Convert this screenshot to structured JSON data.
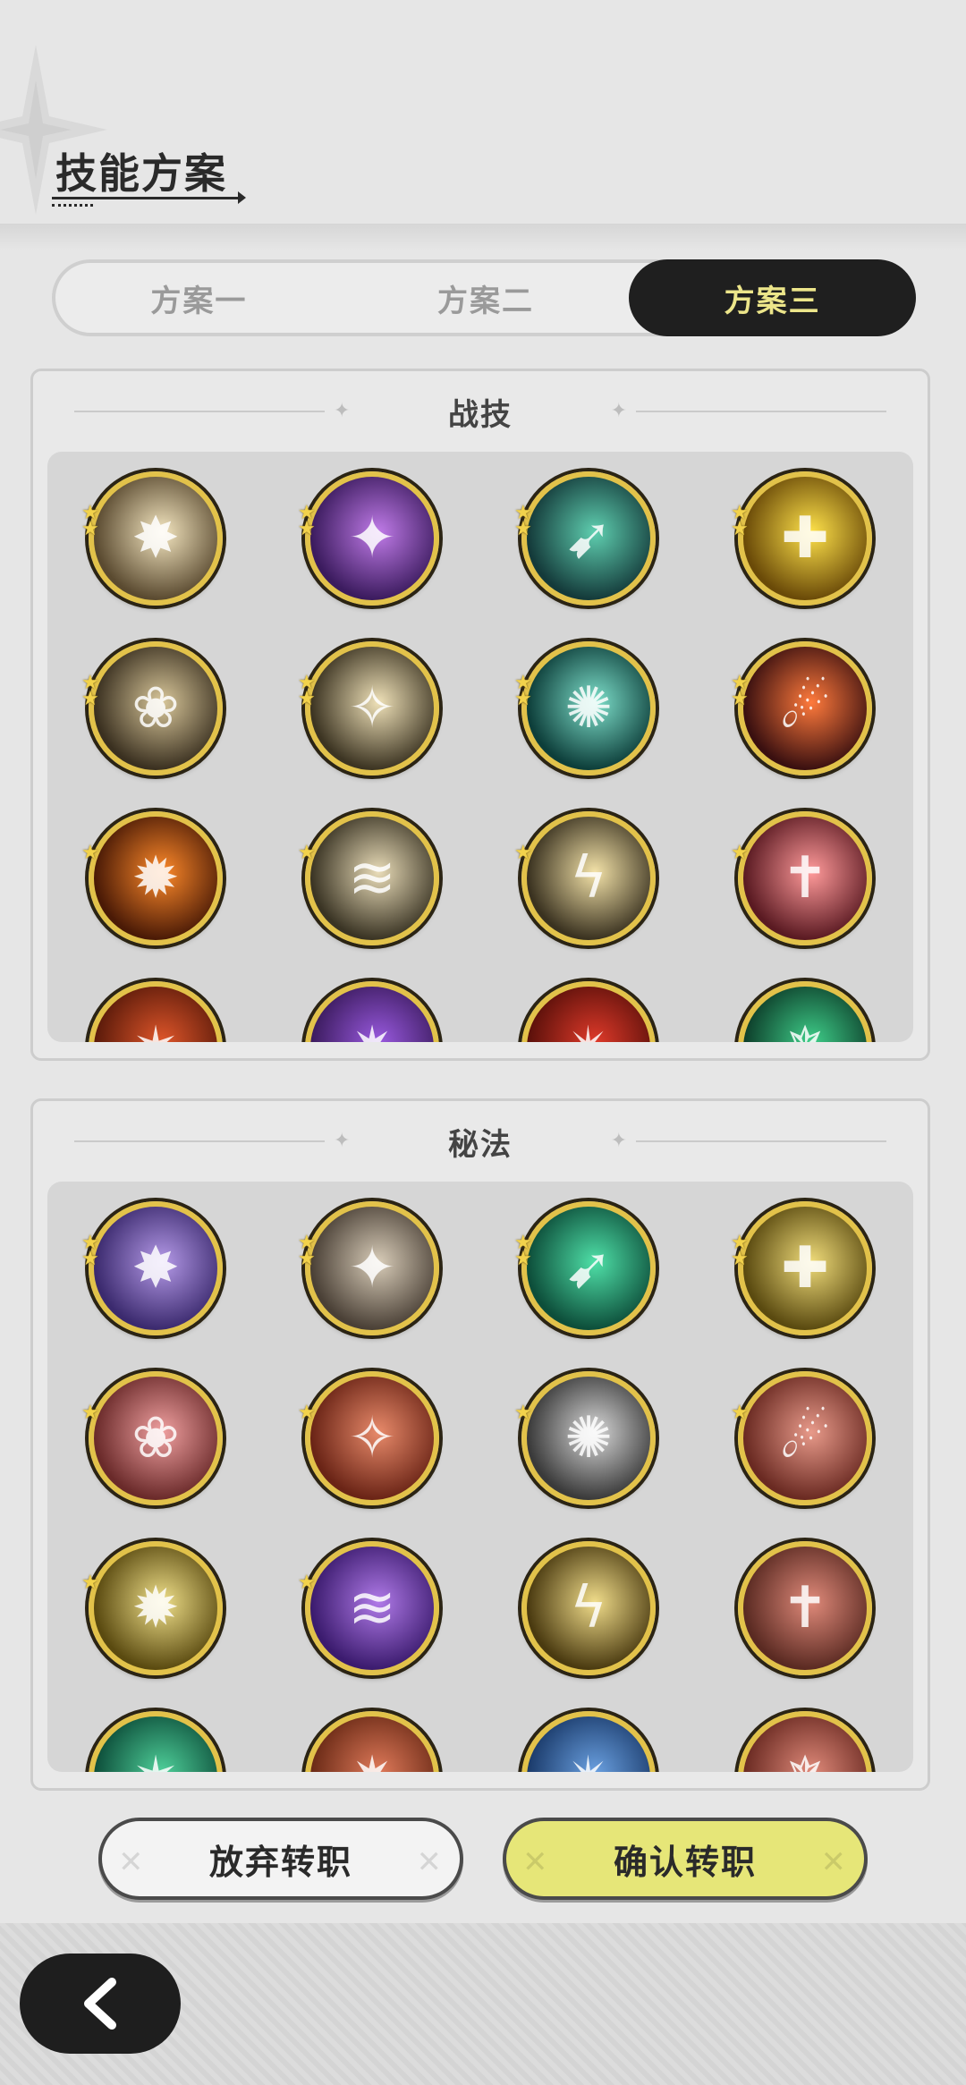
{
  "header": {
    "title": "技能方案"
  },
  "tabs": [
    {
      "label": "方案一",
      "active": false
    },
    {
      "label": "方案二",
      "active": false
    },
    {
      "label": "方案三",
      "active": true
    }
  ],
  "sections": {
    "combat": {
      "title": "战技",
      "skills": [
        {
          "icon": "burst-icon",
          "stars": 2,
          "colors": [
            "#5a4a30",
            "#f4e6c0"
          ]
        },
        {
          "icon": "purple-orb-icon",
          "stars": 2,
          "colors": [
            "#3b1b5e",
            "#c07be8"
          ]
        },
        {
          "icon": "green-slash-icon",
          "stars": 2,
          "colors": [
            "#143a3a",
            "#5fcfb0"
          ]
        },
        {
          "icon": "golden-shield-icon",
          "stars": 2,
          "colors": [
            "#6a4a08",
            "#ffe24a"
          ]
        },
        {
          "icon": "tail-sweep-icon",
          "stars": 2,
          "colors": [
            "#3a3020",
            "#d9c79a"
          ]
        },
        {
          "icon": "figure-leap-icon",
          "stars": 2,
          "colors": [
            "#3c3422",
            "#efe1b8"
          ]
        },
        {
          "icon": "web-icon",
          "stars": 2,
          "colors": [
            "#0d3e3a",
            "#7fe1cc"
          ]
        },
        {
          "icon": "fire-slash-icon",
          "stars": 2,
          "colors": [
            "#3a1010",
            "#ff7a3c"
          ]
        },
        {
          "icon": "flame-icon",
          "stars": 1,
          "colors": [
            "#4a1a06",
            "#ff8a2a"
          ]
        },
        {
          "icon": "wind-slash-icon",
          "stars": 1,
          "colors": [
            "#3a3424",
            "#e9dcb8"
          ]
        },
        {
          "icon": "lightning-slash-icon",
          "stars": 1,
          "colors": [
            "#3a3220",
            "#f3e2a8"
          ]
        },
        {
          "icon": "sword-raise-icon",
          "stars": 1,
          "colors": [
            "#5a1a22",
            "#ff9a9a"
          ]
        },
        {
          "icon": "red-skill-icon",
          "stars": 0,
          "colors": [
            "#5a1a0a",
            "#e0562a"
          ]
        },
        {
          "icon": "purple-skill-icon",
          "stars": 0,
          "colors": [
            "#3b1b5e",
            "#9a5ae0"
          ]
        },
        {
          "icon": "crimson-skill-icon",
          "stars": 0,
          "colors": [
            "#5a100a",
            "#e03a2a"
          ]
        },
        {
          "icon": "teal-skill-icon",
          "stars": 0,
          "colors": [
            "#0d3e2a",
            "#3fcf8a"
          ]
        }
      ]
    },
    "arcane": {
      "title": "秘法",
      "skills": [
        {
          "icon": "raven-icon",
          "stars": 2,
          "colors": [
            "#3b2a6e",
            "#b59ae8"
          ]
        },
        {
          "icon": "sword-up-icon",
          "stars": 2,
          "colors": [
            "#4a4036",
            "#d8ccb8"
          ]
        },
        {
          "icon": "emerald-sword-icon",
          "stars": 2,
          "colors": [
            "#0d4e3a",
            "#4fe0a8"
          ]
        },
        {
          "icon": "heal-guard-icon",
          "stars": 2,
          "colors": [
            "#5a4a10",
            "#f0dc7a"
          ]
        },
        {
          "icon": "red-sword-heal-icon",
          "stars": 1,
          "colors": [
            "#6a2a2a",
            "#f0a0a0"
          ]
        },
        {
          "icon": "red-shatter-icon",
          "stars": 1,
          "colors": [
            "#6a2416",
            "#e88a6a"
          ]
        },
        {
          "icon": "shield-figure-icon",
          "stars": 1,
          "colors": [
            "#3a3a3a",
            "#d8d8d8"
          ]
        },
        {
          "icon": "red-crystal-icon",
          "stars": 1,
          "colors": [
            "#6a2a22",
            "#e89a8a"
          ]
        },
        {
          "icon": "shadow-figure-icon",
          "stars": 1,
          "colors": [
            "#5a4a10",
            "#f0e08a"
          ]
        },
        {
          "icon": "violet-flame-icon",
          "stars": 1,
          "colors": [
            "#3b1b6e",
            "#b07ae8"
          ]
        },
        {
          "icon": "eye-icon",
          "stars": 0,
          "colors": [
            "#4a3a10",
            "#f0dc8a"
          ]
        },
        {
          "icon": "armor-icon",
          "stars": 0,
          "colors": [
            "#5a2a22",
            "#e08a7a"
          ]
        },
        {
          "icon": "green-arcane-icon",
          "stars": 0,
          "colors": [
            "#0d4e3a",
            "#4fd09a"
          ]
        },
        {
          "icon": "red-arcane-icon",
          "stars": 0,
          "colors": [
            "#6a2a16",
            "#e07a5a"
          ]
        },
        {
          "icon": "blue-arcane-icon",
          "stars": 0,
          "colors": [
            "#1a3a6a",
            "#6aa0e0"
          ]
        },
        {
          "icon": "rose-arcane-icon",
          "stars": 0,
          "colors": [
            "#6a2a22",
            "#e08a7a"
          ]
        }
      ]
    }
  },
  "buttons": {
    "cancel": "放弃转职",
    "confirm": "确认转职"
  },
  "back": {
    "icon": "chevron-left-icon"
  }
}
